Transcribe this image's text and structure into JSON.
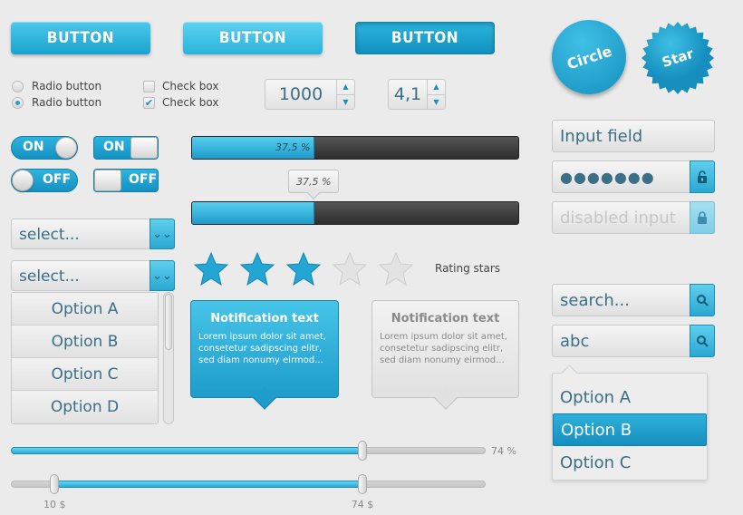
{
  "buttons": [
    "BUTTON",
    "BUTTON",
    "BUTTON"
  ],
  "badges": {
    "circle": "Circle",
    "star": "Star"
  },
  "radio": {
    "opt1": "Radio button",
    "opt2": "Radio button",
    "selected": 2
  },
  "checkbox": {
    "opt1": "Check box",
    "opt2": "Check box",
    "checked": [
      false,
      true
    ]
  },
  "steppers": {
    "first": "1000",
    "second": "4,1"
  },
  "toggles": {
    "on1": "ON",
    "on2": "ON",
    "off1": "OFF",
    "off2": "OFF"
  },
  "progress": {
    "value_percent": 37.5,
    "label": "37,5 %",
    "tooltip": "37,5 %"
  },
  "selects": {
    "first": "select...",
    "second": "select..."
  },
  "listbox": {
    "options": [
      "Option A",
      "Option B",
      "Option C",
      "Option D"
    ]
  },
  "rating": {
    "label": "Rating stars",
    "value": 3,
    "max": 5
  },
  "notifications": [
    {
      "title": "Notification text",
      "body": "Lorem ipsum dolor sit amet, consetetur sadipscing elitr, sed diam nonumy eirmod...",
      "style": "active"
    },
    {
      "title": "Notification text",
      "body": "Lorem ipsum dolor sit amet, consetetur sadipscing elitr, sed diam nonumy eirmod...",
      "style": "inactive"
    }
  ],
  "sliders": {
    "single": {
      "value_percent": 74,
      "label": "74 %"
    },
    "range": {
      "low": 10,
      "high": 74,
      "low_label": "10 $",
      "high_label": "74 $"
    }
  },
  "inputs": {
    "input_field": "Input field",
    "password": "●●●●●●●",
    "disabled": "disabled input",
    "search_placeholder": "search...",
    "search_value": "abc"
  },
  "autocomplete": {
    "options": [
      "Option A",
      "Option B",
      "Option C"
    ],
    "selected_index": 1
  },
  "colors": {
    "accent": "#1aa2cf",
    "accent_dark": "#0f7fab",
    "text": "#3a6f86",
    "background": "#ecebeb"
  }
}
